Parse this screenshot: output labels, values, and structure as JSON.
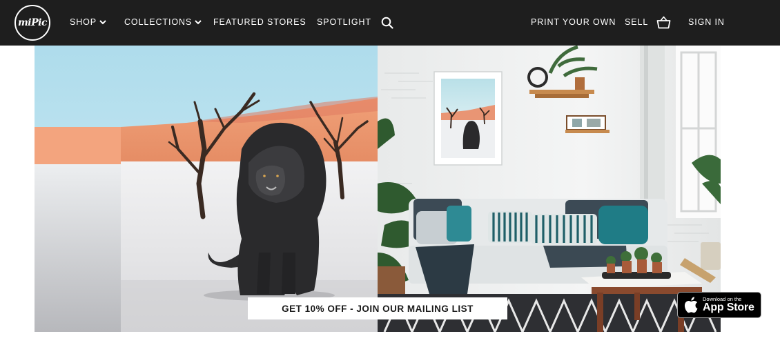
{
  "header": {
    "logo_text": "miPic",
    "nav": {
      "shop": "SHOP",
      "collections": "COLLECTIONS",
      "featured_stores": "FEATURED STORES",
      "spotlight": "SPOTLIGHT",
      "print_your_own": "PRINT YOUR OWN",
      "sell": "SELL",
      "sign_in": "SIGN IN"
    },
    "icons": {
      "search": "search-icon",
      "cart": "shopping-basket-icon",
      "chevron": "chevron-down-icon"
    }
  },
  "hero": {
    "left_image": "black lion sitting in desert with dead trees",
    "right_image": "living room with framed lion print and sofa"
  },
  "promo": {
    "label": "GET 10% OFF - JOIN OUR MAILING LIST"
  },
  "app_badge": {
    "line1": "Download on the",
    "line2": "App Store"
  },
  "colors": {
    "topbar": "#1e1e1e",
    "text": "#ffffff",
    "banner_text": "#1a1a1a"
  }
}
